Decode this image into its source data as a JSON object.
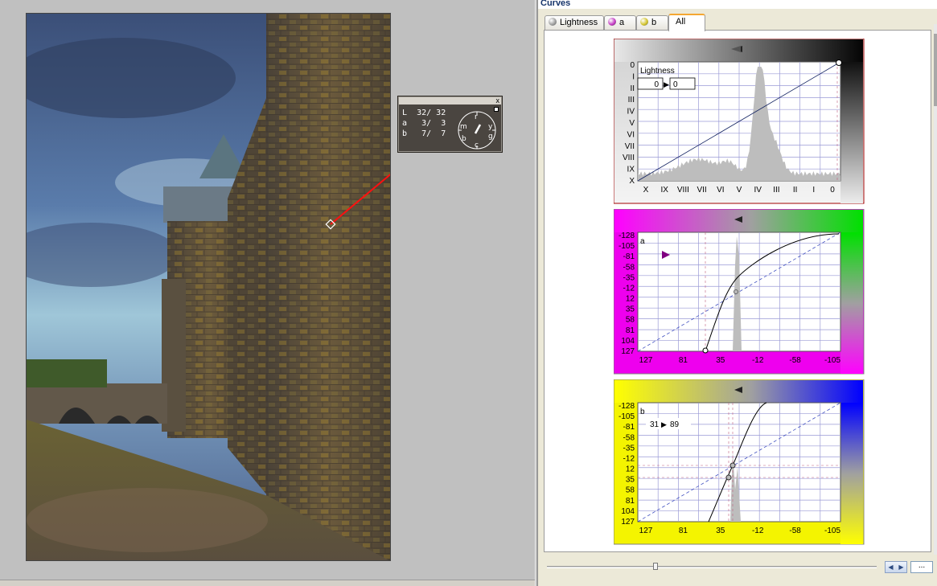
{
  "panel": {
    "title": "Curves"
  },
  "tabs": [
    {
      "label": "Lightness",
      "icon": "gray-sphere-icon",
      "active": false
    },
    {
      "label": "a",
      "icon": "magenta-green-sphere-icon",
      "active": false
    },
    {
      "label": "b",
      "icon": "yellow-blue-sphere-icon",
      "active": false
    },
    {
      "label": "All",
      "icon": "",
      "active": true
    }
  ],
  "readout": {
    "close_glyph": "x",
    "rows": [
      {
        "channel": "L",
        "before": "32",
        "after": "32"
      },
      {
        "channel": "a",
        "before": "3",
        "after": "3"
      },
      {
        "channel": "b",
        "before": "7",
        "after": "7"
      }
    ],
    "dial_letters": [
      "r",
      "y",
      "g",
      "c",
      "b",
      "m"
    ]
  },
  "lightness_curve": {
    "label": "Lightness",
    "input_value": "0",
    "output_value": "0",
    "arrow_glyph": "▶",
    "y_ticks": [
      "0",
      "I",
      "II",
      "III",
      "IV",
      "V",
      "VI",
      "VII",
      "VIII",
      "IX",
      "X"
    ],
    "x_ticks": [
      "X",
      "IX",
      "VIII",
      "VII",
      "VI",
      "V",
      "IV",
      "III",
      "II",
      "I",
      "0"
    ],
    "colors": {
      "border": "#a00000",
      "grid": "#9a9ad6",
      "histogram": "#bdbdbd"
    }
  },
  "a_curve": {
    "label": "a",
    "y_ticks": [
      "-128",
      "-105",
      "-81",
      "-58",
      "-35",
      "-12",
      "12",
      "35",
      "58",
      "81",
      "104",
      "127"
    ],
    "x_ticks": [
      "127",
      "81",
      "35",
      "-12",
      "-58",
      "-105"
    ],
    "colors": {
      "magenta": "#ff00ff",
      "green": "#00e000"
    }
  },
  "b_curve": {
    "label": "b",
    "point_in": "31",
    "point_out": "89",
    "arrow_glyph": "▶",
    "y_ticks": [
      "-128",
      "-105",
      "-81",
      "-58",
      "-35",
      "-12",
      "12",
      "35",
      "58",
      "81",
      "104",
      "127"
    ],
    "x_ticks": [
      "127",
      "81",
      "35",
      "-12",
      "-58",
      "-105"
    ],
    "colors": {
      "yellow": "#ffff00",
      "blue": "#0000ff"
    }
  },
  "bottom": {
    "slider_level": 0.33,
    "spin_left": "◀",
    "spin_right": "▶",
    "more_label": "..."
  }
}
